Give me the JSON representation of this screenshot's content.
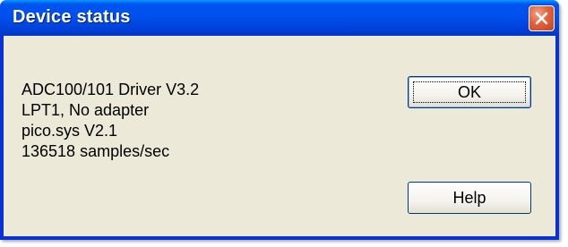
{
  "dialog": {
    "title": "Device status",
    "close_icon": "close-icon",
    "info_lines": [
      "ADC100/101 Driver V3.2",
      "LPT1, No adapter",
      "pico.sys V2.1",
      "136518 samples/sec"
    ],
    "ok_label": "OK",
    "help_label": "Help"
  },
  "colors": {
    "titlebar": "#0054e3",
    "client_background": "#ece9d8",
    "close_button": "#e2613a"
  }
}
